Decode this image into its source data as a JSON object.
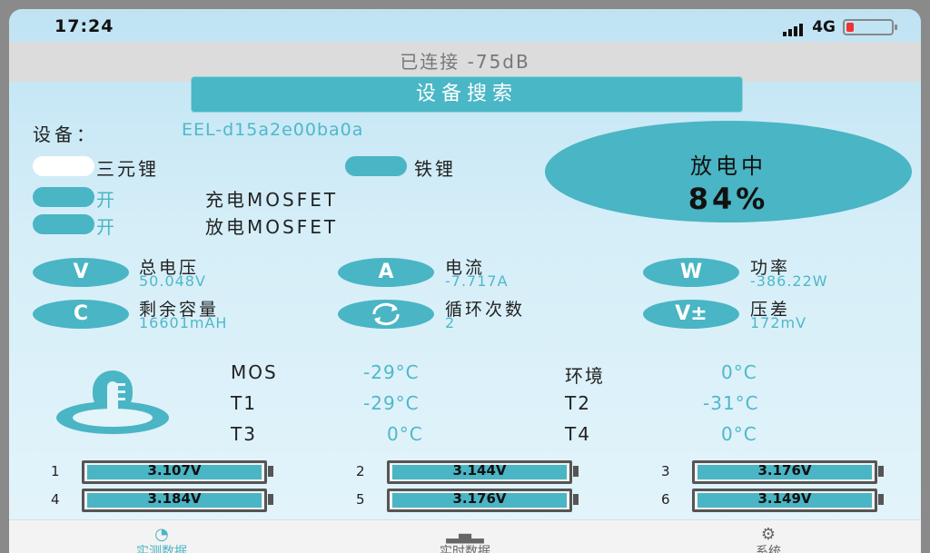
{
  "status": {
    "time": "17:24",
    "network": "4G"
  },
  "connection": "已连接 -75dB",
  "scan_button": "设备搜索",
  "device": {
    "label": "设备：",
    "id": "EEL-d15a2e00ba0a"
  },
  "chemistry": {
    "option1": "三元锂",
    "option2": "铁锂"
  },
  "mosfet": {
    "charge": {
      "state": "开",
      "label": "充电MOSFET"
    },
    "discharge": {
      "state": "开",
      "label": "放电MOSFET"
    }
  },
  "battery_state": {
    "status": "放电中",
    "percent": "84%"
  },
  "metrics": [
    {
      "icon": "V",
      "name": "总电压",
      "value": "50.048V"
    },
    {
      "icon": "A",
      "name": "电流",
      "value": "-7.717A"
    },
    {
      "icon": "W",
      "name": "功率",
      "value": "-386.22W"
    },
    {
      "icon": "C",
      "name": "剩余容量",
      "value": "16601mAH"
    },
    {
      "icon": "cycle-icon",
      "name": "循环次数",
      "value": "2"
    },
    {
      "icon": "V±",
      "name": "压差",
      "value": "172mV"
    }
  ],
  "temps": [
    {
      "label": "MOS",
      "value": "-29°C"
    },
    {
      "label": "环境",
      "value": "0°C"
    },
    {
      "label": "T1",
      "value": "-29°C"
    },
    {
      "label": "T2",
      "value": "-31°C"
    },
    {
      "label": "T3",
      "value": "0°C"
    },
    {
      "label": "T4",
      "value": "0°C"
    }
  ],
  "cells": [
    {
      "index": "1",
      "voltage": "3.107V"
    },
    {
      "index": "2",
      "voltage": "3.144V"
    },
    {
      "index": "3",
      "voltage": "3.176V"
    },
    {
      "index": "4",
      "voltage": "3.184V"
    },
    {
      "index": "5",
      "voltage": "3.176V"
    },
    {
      "index": "6",
      "voltage": "3.149V"
    }
  ],
  "nav": [
    {
      "label": "实测数据",
      "icon": "gauge-icon"
    },
    {
      "label": "实时数据",
      "icon": "bar-chart-icon"
    },
    {
      "label": "系统",
      "icon": "gear-icon"
    }
  ],
  "colors": {
    "accent": "#4ab5c4",
    "background": "#d5eef8"
  }
}
